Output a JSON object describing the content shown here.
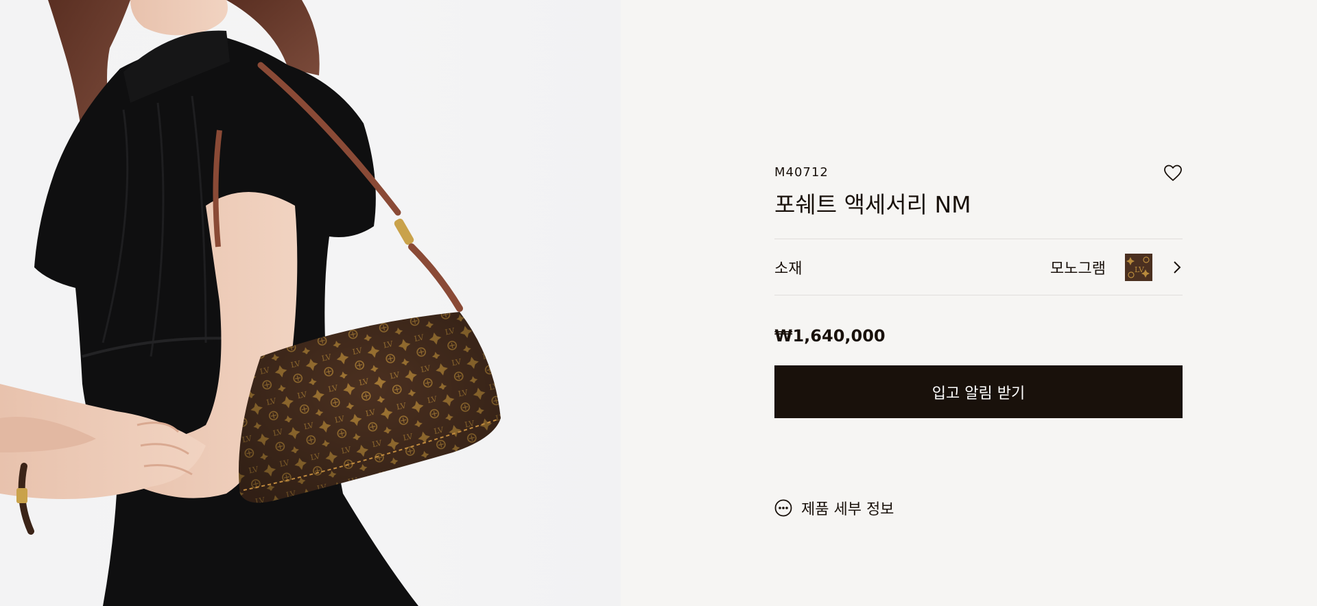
{
  "product": {
    "sku": "M40712",
    "name": "포쉐트 액세서리 NM",
    "price": "₩1,640,000"
  },
  "material": {
    "label": "소재",
    "value": "모노그램"
  },
  "actions": {
    "notify_label": "입고 알림 받기",
    "details_label": "제품 세부 정보"
  },
  "icons": {
    "wishlist": "heart-outline-icon",
    "material_chevron": "chevron-right-icon",
    "details": "more-circle-icon"
  },
  "colors": {
    "text": "#19110b",
    "button_bg": "#19110b",
    "button_text": "#ffffff",
    "divider": "#e1dedb",
    "panel_bg": "#f6f5f3",
    "monogram_brown": "#4b3020",
    "monogram_gold": "#b88a3c"
  }
}
